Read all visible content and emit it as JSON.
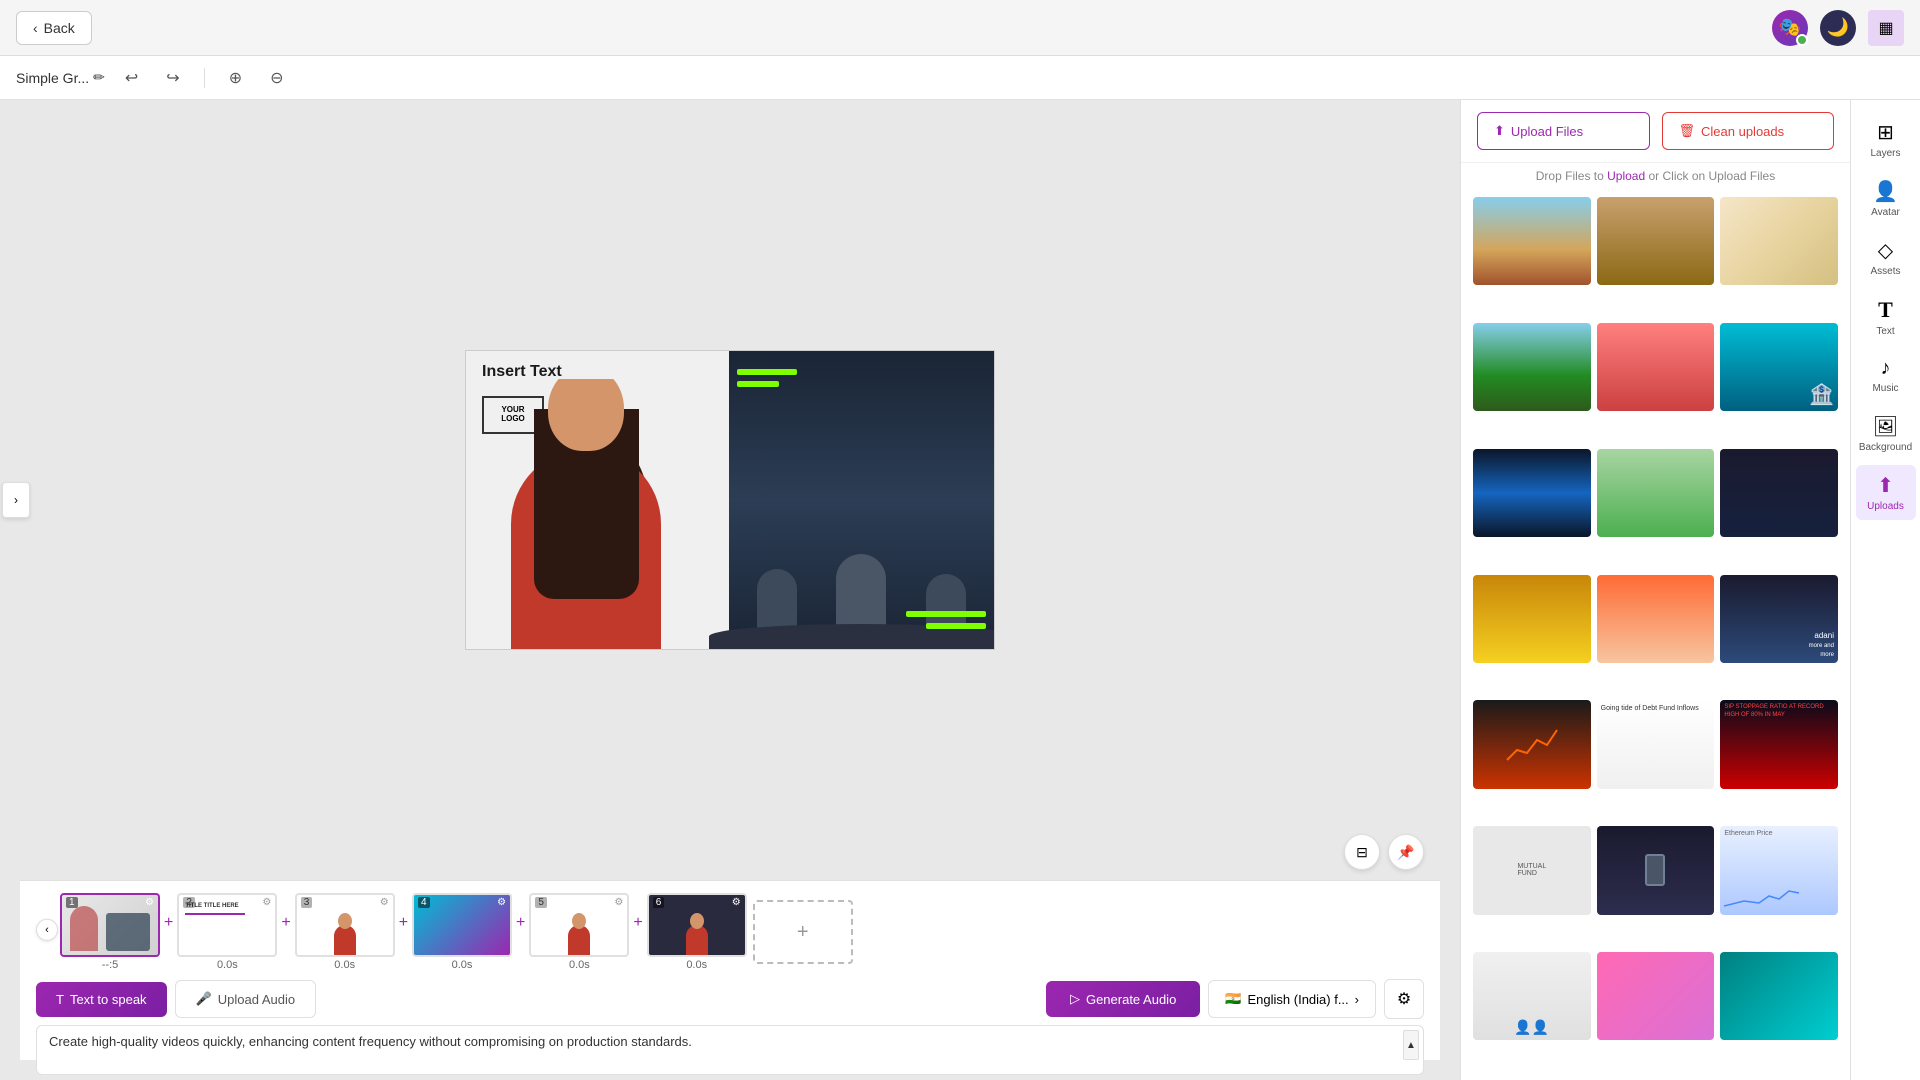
{
  "topbar": {
    "back_label": "Back",
    "project_name": "Simple Gr...",
    "edit_icon": "✏",
    "undo_icon": "↩",
    "redo_icon": "↪",
    "zoom_in_icon": "⊕",
    "zoom_out_icon": "⊖",
    "avatar_emoji": "🎭",
    "theme_icon": "🌙",
    "panel_icon": "▦"
  },
  "right_panel": {
    "upload_files_label": "Upload Files",
    "clean_uploads_label": "Clean uploads",
    "drop_text_prefix": "Drop Files to ",
    "drop_link": "Upload",
    "drop_text_suffix": " or Click on Upload Files"
  },
  "side_icons": [
    {
      "id": "layers",
      "icon": "⊞",
      "label": "Layers"
    },
    {
      "id": "avatar",
      "icon": "👤",
      "label": "Avatar"
    },
    {
      "id": "assets",
      "icon": "◇",
      "label": "Assets"
    },
    {
      "id": "text",
      "icon": "T",
      "label": "Text"
    },
    {
      "id": "music",
      "icon": "♪",
      "label": "Music"
    },
    {
      "id": "background",
      "icon": "⬜",
      "label": "Background"
    },
    {
      "id": "uploads",
      "icon": "⬆",
      "label": "Uploads",
      "active": true
    }
  ],
  "canvas": {
    "insert_text": "Insert Text",
    "logo_line1": "YOUR",
    "logo_line2": "LOGO"
  },
  "slides": [
    {
      "num": "1",
      "time": "--:5",
      "bg": "slide-bg-1",
      "active": true,
      "has_presenter": true
    },
    {
      "num": "2",
      "time": "0.0s",
      "bg": "slide-bg-2",
      "active": false,
      "has_presenter": false
    },
    {
      "num": "3",
      "time": "0.0s",
      "bg": "slide-bg-3",
      "active": false,
      "has_presenter": false
    },
    {
      "num": "4",
      "time": "0.0s",
      "bg": "slide-bg-4",
      "active": false,
      "has_presenter": false
    },
    {
      "num": "5",
      "time": "0.0s",
      "bg": "slide-bg-5",
      "active": false,
      "has_presenter": true
    },
    {
      "num": "6",
      "time": "0.0s",
      "bg": "slide-bg-6",
      "active": false,
      "has_presenter": true
    }
  ],
  "audio": {
    "text_to_speak_label": "Text to speak",
    "upload_audio_label": "Upload Audio",
    "generate_audio_label": "Generate Audio",
    "language_label": "English (India) f...",
    "textarea_text": "Create high-quality videos quickly, enhancing content frequency without compromising on production standards."
  },
  "images": [
    {
      "id": "buildings",
      "css_class": "img-buildings"
    },
    {
      "id": "stadium",
      "css_class": "img-stadium"
    },
    {
      "id": "map",
      "css_class": "img-map"
    },
    {
      "id": "fields",
      "css_class": "img-fields"
    },
    {
      "id": "piggy",
      "css_class": "img-piggy"
    },
    {
      "id": "bank",
      "css_class": "img-bank"
    },
    {
      "id": "chart-dark",
      "css_class": "img-chart"
    },
    {
      "id": "house",
      "css_class": "img-house"
    },
    {
      "id": "crane",
      "css_class": "img-crane"
    },
    {
      "id": "goldcoins",
      "css_class": "img-goldcoins"
    },
    {
      "id": "sunset",
      "css_class": "img-sunset"
    },
    {
      "id": "adani",
      "css_class": "img-adani"
    },
    {
      "id": "growth",
      "css_class": "img-growth"
    },
    {
      "id": "debtfund",
      "css_class": "img-debtfund"
    },
    {
      "id": "sip",
      "css_class": "img-sip"
    },
    {
      "id": "mutualfund",
      "css_class": "img-mutualfund"
    },
    {
      "id": "phone",
      "css_class": "img-phone"
    },
    {
      "id": "ethereum",
      "css_class": "img-ethereum"
    },
    {
      "id": "people",
      "css_class": "img-people"
    },
    {
      "id": "gradient-pink",
      "css_class": "img-gradient"
    },
    {
      "id": "teal",
      "css_class": "img-teal"
    }
  ]
}
